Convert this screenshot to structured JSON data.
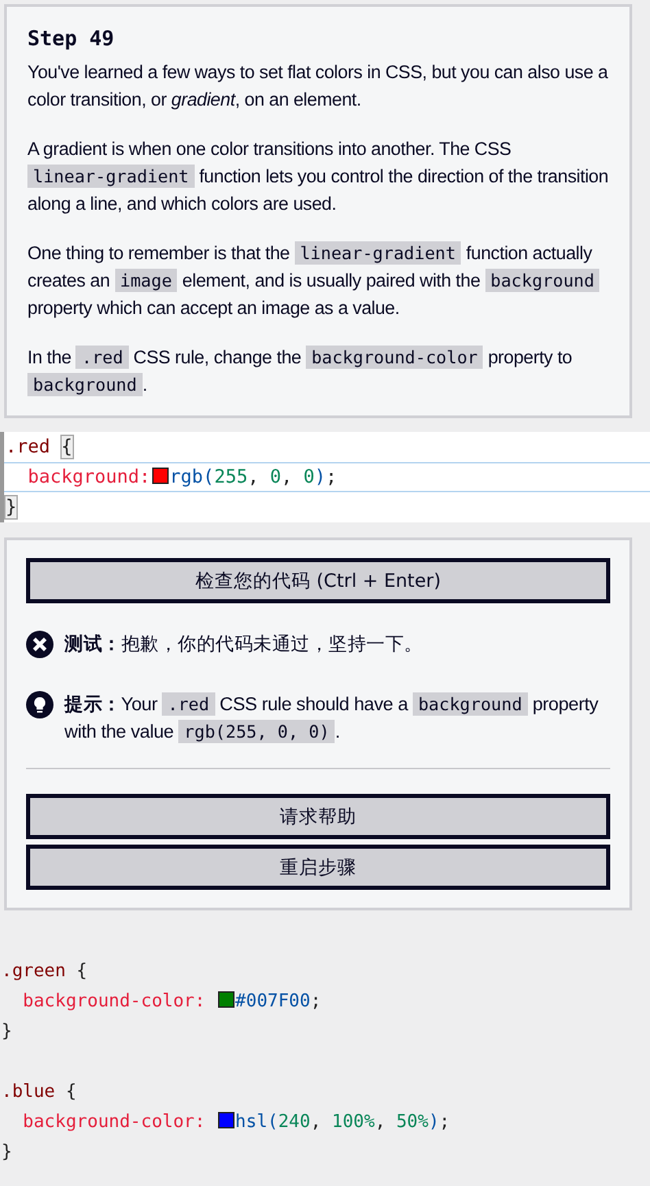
{
  "instructions": {
    "title": "Step 49",
    "paragraphs": [
      [
        {
          "kind": "text",
          "text": "You've learned a few ways to set flat colors in CSS, but you can also use a color transition, or *gradient*, on an element."
        }
      ],
      [
        {
          "kind": "text",
          "text": "A gradient is when one color transitions into another. The CSS "
        },
        {
          "kind": "code",
          "text": "linear-gradient"
        },
        {
          "kind": "text",
          "text": " function lets you control the direction of the transition along a line, and which colors are used."
        }
      ],
      [
        {
          "kind": "text",
          "text": "One thing to remember is that the "
        },
        {
          "kind": "code",
          "text": "linear-gradient"
        },
        {
          "kind": "text",
          "text": " function actually creates an "
        },
        {
          "kind": "code",
          "text": "image"
        },
        {
          "kind": "text",
          "text": " element, and is usually paired with the "
        },
        {
          "kind": "code",
          "text": "background"
        },
        {
          "kind": "text",
          "text": " property which can accept an image as a value."
        }
      ],
      [
        {
          "kind": "text",
          "text": "In the "
        },
        {
          "kind": "code",
          "text": ".red"
        },
        {
          "kind": "text",
          "text": " CSS rule, change the "
        },
        {
          "kind": "code",
          "text": "background-color"
        },
        {
          "kind": "text",
          "text": " property to "
        },
        {
          "kind": "code",
          "text": "background"
        },
        {
          "kind": "text",
          "text": "."
        }
      ]
    ]
  },
  "editor": {
    "lines": [
      {
        "active": false,
        "bracket_highlighted": true,
        "tokens": [
          {
            "kind": "selector",
            "text": ".red"
          },
          {
            "kind": "brace",
            "text": "{"
          }
        ]
      },
      {
        "active": true,
        "tokens": [
          {
            "kind": "property",
            "text": "  background:"
          },
          {
            "kind": "swatch",
            "color": "#ff0000"
          },
          {
            "kind": "func",
            "text": "rgb("
          },
          {
            "kind": "number",
            "text": "255"
          },
          {
            "kind": "punct",
            "text": ", "
          },
          {
            "kind": "number",
            "text": "0"
          },
          {
            "kind": "punct",
            "text": ", "
          },
          {
            "kind": "number",
            "text": "0"
          },
          {
            "kind": "func",
            "text": ")"
          },
          {
            "kind": "punct",
            "text": ";"
          }
        ]
      },
      {
        "active": false,
        "bracket_highlighted": true,
        "tokens": [
          {
            "kind": "brace",
            "text": "}"
          }
        ]
      }
    ]
  },
  "feedback": {
    "check_button": "检查您的代码 (Ctrl + Enter)",
    "test": {
      "passed": false,
      "label": "测试：",
      "text": "抱歉，你的代码未通过，坚持一下。"
    },
    "hint": {
      "label": "提示：",
      "segments": [
        {
          "kind": "text",
          "text": "Your "
        },
        {
          "kind": "code",
          "text": ".red"
        },
        {
          "kind": "text",
          "text": " CSS rule should have a "
        },
        {
          "kind": "code",
          "text": "background"
        },
        {
          "kind": "text",
          "text": " property with the value "
        },
        {
          "kind": "code",
          "text": "rgb(255, 0, 0)"
        },
        {
          "kind": "text",
          "text": "."
        }
      ]
    },
    "buttons": [
      "请求帮助",
      "重启步骤"
    ]
  },
  "preview_code": {
    "lines": [
      {
        "kind": "blank"
      },
      {
        "kind": "code",
        "tokens": [
          {
            "kind": "selector",
            "text": ".green"
          },
          {
            "kind": "punct",
            "text": " {"
          }
        ]
      },
      {
        "kind": "code",
        "tokens": [
          {
            "kind": "property",
            "text": "  background-color: "
          },
          {
            "kind": "swatch",
            "color": "#007f00"
          },
          {
            "kind": "func",
            "text": "#007F00"
          },
          {
            "kind": "punct",
            "text": ";"
          }
        ]
      },
      {
        "kind": "code",
        "tokens": [
          {
            "kind": "punct",
            "text": "}"
          }
        ]
      },
      {
        "kind": "blank"
      },
      {
        "kind": "code",
        "tokens": [
          {
            "kind": "selector",
            "text": ".blue"
          },
          {
            "kind": "punct",
            "text": " {"
          }
        ]
      },
      {
        "kind": "code",
        "tokens": [
          {
            "kind": "property",
            "text": "  background-color: "
          },
          {
            "kind": "swatch",
            "color": "#0000ff"
          },
          {
            "kind": "func",
            "text": "hsl("
          },
          {
            "kind": "number",
            "text": "240"
          },
          {
            "kind": "punct",
            "text": ", "
          },
          {
            "kind": "number",
            "text": "100%"
          },
          {
            "kind": "punct",
            "text": ", "
          },
          {
            "kind": "number",
            "text": "50%"
          },
          {
            "kind": "func",
            "text": ")"
          },
          {
            "kind": "punct",
            "text": ";"
          }
        ]
      },
      {
        "kind": "code",
        "tokens": [
          {
            "kind": "punct",
            "text": "}"
          }
        ]
      }
    ]
  }
}
